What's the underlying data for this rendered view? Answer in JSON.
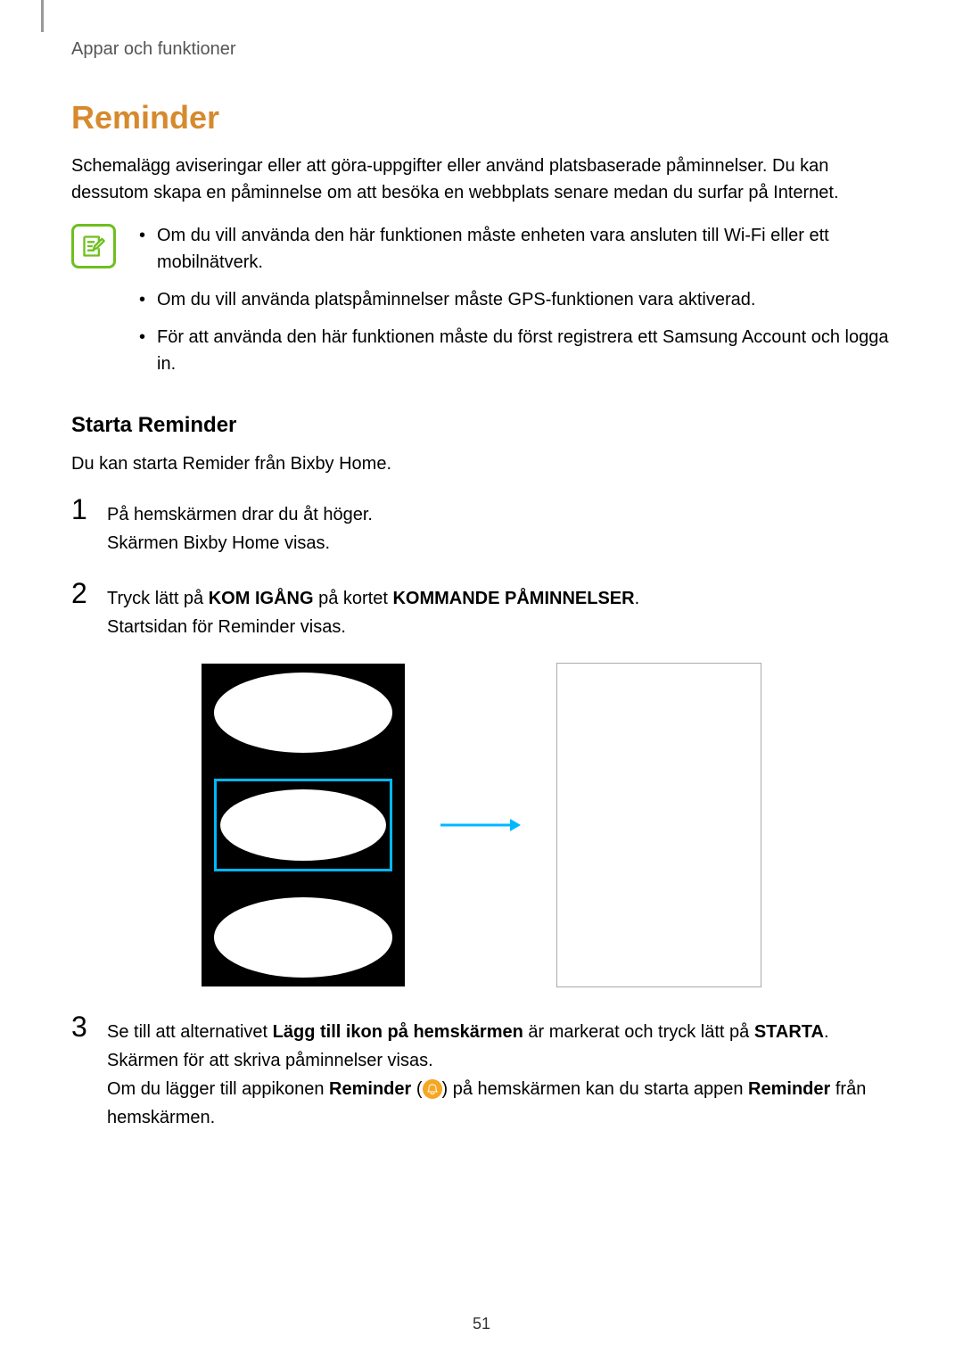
{
  "header": "Appar och funktioner",
  "title": "Reminder",
  "intro": "Schemalägg aviseringar eller att göra-uppgifter eller använd platsbaserade påminnelser. Du kan dessutom skapa en påminnelse om att besöka en webbplats senare medan du surfar på Internet.",
  "notes": [
    "Om du vill använda den här funktionen måste enheten vara ansluten till Wi-Fi eller ett mobilnätverk.",
    "Om du vill använda platspåminnelser måste GPS-funktionen vara aktiverad.",
    "För att använda den här funktionen måste du först registrera ett Samsung Account och logga in."
  ],
  "subheading": "Starta Reminder",
  "subintro": "Du kan starta Remider från Bixby Home.",
  "steps": {
    "s1": {
      "num": "1",
      "line1": "På hemskärmen drar du åt höger.",
      "line2": "Skärmen Bixby Home visas."
    },
    "s2": {
      "num": "2",
      "pre": "Tryck lätt på ",
      "bold1": "KOM IGÅNG",
      "mid": " på kortet ",
      "bold2": "KOMMANDE PÅMINNELSER",
      "post": ".",
      "line2": "Startsidan för Reminder visas."
    },
    "s3": {
      "num": "3",
      "pre": "Se till att alternativet ",
      "bold1": "Lägg till ikon på hemskärmen",
      "mid": " är markerat och tryck lätt på ",
      "bold2": "STARTA",
      "post": ".",
      "line2": "Skärmen för att skriva påminnelser visas.",
      "line3_pre": "Om du lägger till appikonen ",
      "line3_b1": "Reminder",
      "line3_mid": " (",
      "line3_post_icon": ") på hemskärmen kan du starta appen ",
      "line3_b2": "Reminder",
      "line3_end": " från hemskärmen."
    }
  },
  "page_number": "51"
}
